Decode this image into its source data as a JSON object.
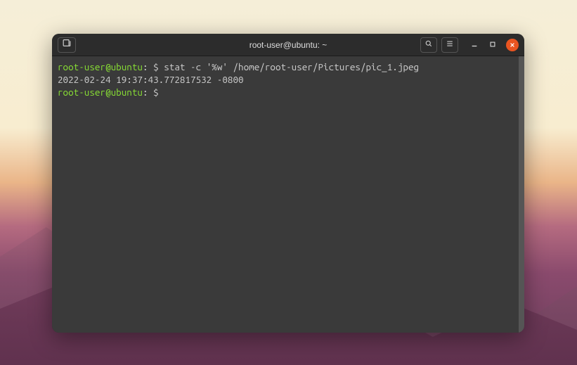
{
  "window": {
    "title": "root-user@ubuntu: ~"
  },
  "terminal": {
    "lines": [
      {
        "prompt_user": "root-user@ubuntu",
        "prompt_separator": ":",
        "path": "",
        "prompt_symbol": " $ ",
        "command": "stat -c '%w' /home/root-user/Pictures/pic_1.jpeg"
      },
      {
        "output": "2022-02-24 19:37:43.772817532 -0800"
      },
      {
        "prompt_user": "root-user@ubuntu",
        "prompt_separator": ":",
        "path": "",
        "prompt_symbol": " $ ",
        "command": ""
      }
    ]
  },
  "icons": {
    "new_tab": "new-tab-icon",
    "search": "search-icon",
    "menu": "hamburger-icon",
    "minimize": "minimize-icon",
    "maximize": "maximize-icon",
    "close": "close-icon"
  }
}
